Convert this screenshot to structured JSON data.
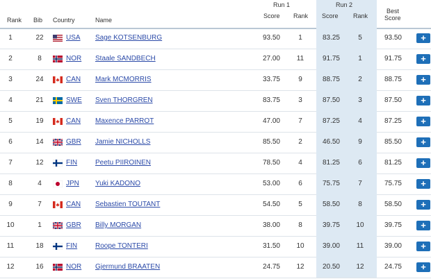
{
  "header": {
    "rank": "Rank",
    "bib": "Bib",
    "country": "Country",
    "name": "Name",
    "run1": "Run 1",
    "run2": "Run 2",
    "score": "Score",
    "run_rank": "Rank",
    "best_line1": "Best",
    "best_line2": "Score"
  },
  "expand_symbol": "+",
  "colors": {
    "link": "#2b4aa8",
    "button": "#1e6fb8",
    "highlight": "#dde9f3"
  },
  "rows": [
    {
      "rank": "1",
      "bib": "22",
      "country": "USA",
      "flag": "usa-flag-icon",
      "name": "Sage KOTSENBURG",
      "run1_score": "93.50",
      "run1_rank": "1",
      "run2_score": "83.25",
      "run2_rank": "5",
      "best": "93.50"
    },
    {
      "rank": "2",
      "bib": "8",
      "country": "NOR",
      "flag": "nor-flag-icon",
      "name": "Staale SANDBECH",
      "run1_score": "27.00",
      "run1_rank": "11",
      "run2_score": "91.75",
      "run2_rank": "1",
      "best": "91.75"
    },
    {
      "rank": "3",
      "bib": "24",
      "country": "CAN",
      "flag": "can-flag-icon",
      "name": "Mark MCMORRIS",
      "run1_score": "33.75",
      "run1_rank": "9",
      "run2_score": "88.75",
      "run2_rank": "2",
      "best": "88.75"
    },
    {
      "rank": "4",
      "bib": "21",
      "country": "SWE",
      "flag": "swe-flag-icon",
      "name": "Sven THORGREN",
      "run1_score": "83.75",
      "run1_rank": "3",
      "run2_score": "87.50",
      "run2_rank": "3",
      "best": "87.50"
    },
    {
      "rank": "5",
      "bib": "19",
      "country": "CAN",
      "flag": "can-flag-icon",
      "name": "Maxence PARROT",
      "run1_score": "47.00",
      "run1_rank": "7",
      "run2_score": "87.25",
      "run2_rank": "4",
      "best": "87.25"
    },
    {
      "rank": "6",
      "bib": "14",
      "country": "GBR",
      "flag": "gbr-flag-icon",
      "name": "Jamie NICHOLLS",
      "run1_score": "85.50",
      "run1_rank": "2",
      "run2_score": "46.50",
      "run2_rank": "9",
      "best": "85.50"
    },
    {
      "rank": "7",
      "bib": "12",
      "country": "FIN",
      "flag": "fin-flag-icon",
      "name": "Peetu PIIROINEN",
      "run1_score": "78.50",
      "run1_rank": "4",
      "run2_score": "81.25",
      "run2_rank": "6",
      "best": "81.25"
    },
    {
      "rank": "8",
      "bib": "4",
      "country": "JPN",
      "flag": "jpn-flag-icon",
      "name": "Yuki KADONO",
      "run1_score": "53.00",
      "run1_rank": "6",
      "run2_score": "75.75",
      "run2_rank": "7",
      "best": "75.75"
    },
    {
      "rank": "9",
      "bib": "7",
      "country": "CAN",
      "flag": "can-flag-icon",
      "name": "Sebastien TOUTANT",
      "run1_score": "54.50",
      "run1_rank": "5",
      "run2_score": "58.50",
      "run2_rank": "8",
      "best": "58.50"
    },
    {
      "rank": "10",
      "bib": "1",
      "country": "GBR",
      "flag": "gbr-flag-icon",
      "name": "Billy MORGAN",
      "run1_score": "38.00",
      "run1_rank": "8",
      "run2_score": "39.75",
      "run2_rank": "10",
      "best": "39.75"
    },
    {
      "rank": "11",
      "bib": "18",
      "country": "FIN",
      "flag": "fin-flag-icon",
      "name": "Roope TONTERI",
      "run1_score": "31.50",
      "run1_rank": "10",
      "run2_score": "39.00",
      "run2_rank": "11",
      "best": "39.00"
    },
    {
      "rank": "12",
      "bib": "16",
      "country": "NOR",
      "flag": "nor-flag-icon",
      "name": "Gjermund BRAATEN",
      "run1_score": "24.75",
      "run1_rank": "12",
      "run2_score": "20.50",
      "run2_rank": "12",
      "best": "24.75"
    }
  ]
}
